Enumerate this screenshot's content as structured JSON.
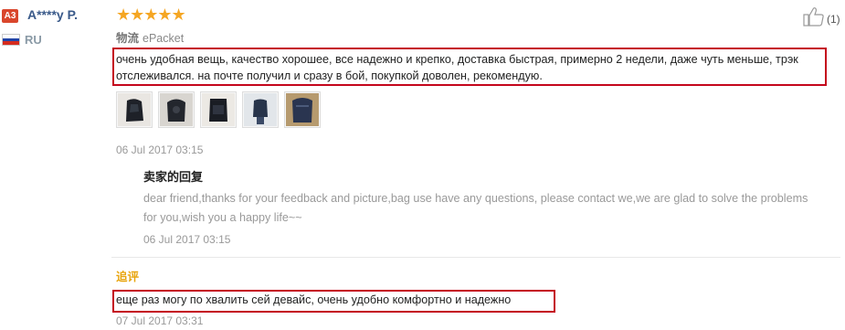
{
  "reviewer": {
    "badge": "A3",
    "name": "A****y P.",
    "country": "RU",
    "flag_colors": [
      "#ffffff",
      "#2045a8",
      "#d52b1e"
    ]
  },
  "rating": {
    "stars": "★★★★★",
    "value": 5,
    "color": "#f5a623"
  },
  "helpful": {
    "count": "(1)",
    "icon": "thumbs-up-icon"
  },
  "shipping": {
    "label": "物流",
    "method": "ePacket"
  },
  "review": {
    "text": "очень удобная вещь, качество хорошее, все надежно и крепко, доставка быстрая, примерно 2 недели, даже чуть меньше, трэк отслеживался. на почте получил и сразу в бой, покупкой доволен, рекомендую.",
    "photos": [
      "photo-1",
      "photo-2",
      "photo-3",
      "photo-4",
      "photo-5"
    ],
    "date": "06 Jul 2017 03:15"
  },
  "seller_reply": {
    "title": "卖家的回复",
    "text": "dear friend,thanks for your feedback and picture,bag use have any questions, please contact we,we are glad to solve the problems for you,wish you a happy life~~",
    "date": "06 Jul 2017 03:15"
  },
  "followup": {
    "title": "追评",
    "text": "еще раз могу по хвалить сей девайс, очень удобно комфортно и надежно",
    "date": "07 Jul 2017 03:31"
  },
  "colors": {
    "highlight_border": "#c4061c",
    "accent": "#e8a40c",
    "link": "#3a5a8a"
  }
}
